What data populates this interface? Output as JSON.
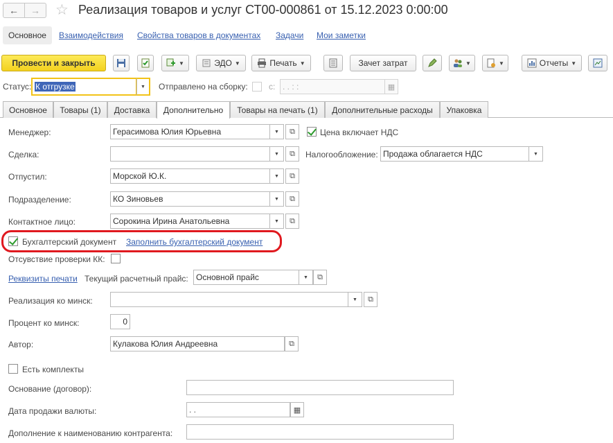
{
  "window": {
    "title": "Реализация товаров и услуг СТ00-000861 от 15.12.2023 0:00:00",
    "back_icon": "←",
    "forward_icon": "→",
    "star_icon": "☆"
  },
  "topnav": {
    "active": "Основное",
    "links": [
      "Взаимодействия",
      "Свойства товаров в документах",
      "Задачи",
      "Мои заметки"
    ]
  },
  "toolbar": {
    "post_close": "Провести и закрыть",
    "edo": "ЭДО",
    "print": "Печать",
    "cost_offset": "Зачет затрат",
    "reports": "Отчеты"
  },
  "status": {
    "label": "Статус:",
    "value": "К отгрузке",
    "sent_label": "Отправлено на сборку:",
    "from_label": "с:",
    "date_placeholder": " .  .      :  :"
  },
  "tabs": [
    "Основное",
    "Товары (1)",
    "Доставка",
    "Дополнительно",
    "Товары на печать (1)",
    "Дополнительные расходы",
    "Упаковка"
  ],
  "form": {
    "manager_label": "Менеджер:",
    "manager_value": "Герасимова Юлия Юрьевна",
    "vat_included_label": "Цена включает НДС",
    "deal_label": "Сделка:",
    "deal_value": "",
    "taxation_label": "Налогообложение:",
    "taxation_value": "Продажа облагается НДС",
    "released_label": "Отпустил:",
    "released_value": "Морской Ю.К.",
    "department_label": "Подразделение:",
    "department_value": "КО Зиновьев",
    "contact_label": "Контактное лицо:",
    "contact_value": "Сорокина Ирина Анатольевна",
    "acc_doc_label": "Бухгалтерский документ",
    "acc_doc_link": "Заполнить бухгалтерский документ",
    "no_kk_label": "Отсувствие проверки КК:",
    "print_details_link": "Реквизиты печати",
    "price_label": "Текущий расчетный прайс:",
    "price_value": "Основной прайс",
    "minsk_sale_label": "Реализация ко минск:",
    "minsk_sale_value": "",
    "minsk_pct_label": "Процент ко минск:",
    "minsk_pct_value": "0",
    "author_label": "Автор:",
    "author_value": "Кулакова Юлия Андреевна",
    "kits_label": "Есть комплекты",
    "basis_label": "Основание (договор):",
    "basis_value": "",
    "currency_date_label": "Дата продажи валюты:",
    "currency_date_value": " .  .",
    "addition_label": "Дополнение к наименованию контрагента:",
    "addition_value": ""
  },
  "icons": {
    "dropdown": "▼",
    "open": "⧉",
    "calendar": "▦"
  },
  "colors": {
    "primary_button": "#f5d423",
    "link": "#3860b0",
    "highlight_oval": "#e0191f",
    "check": "#2d9a2d"
  }
}
